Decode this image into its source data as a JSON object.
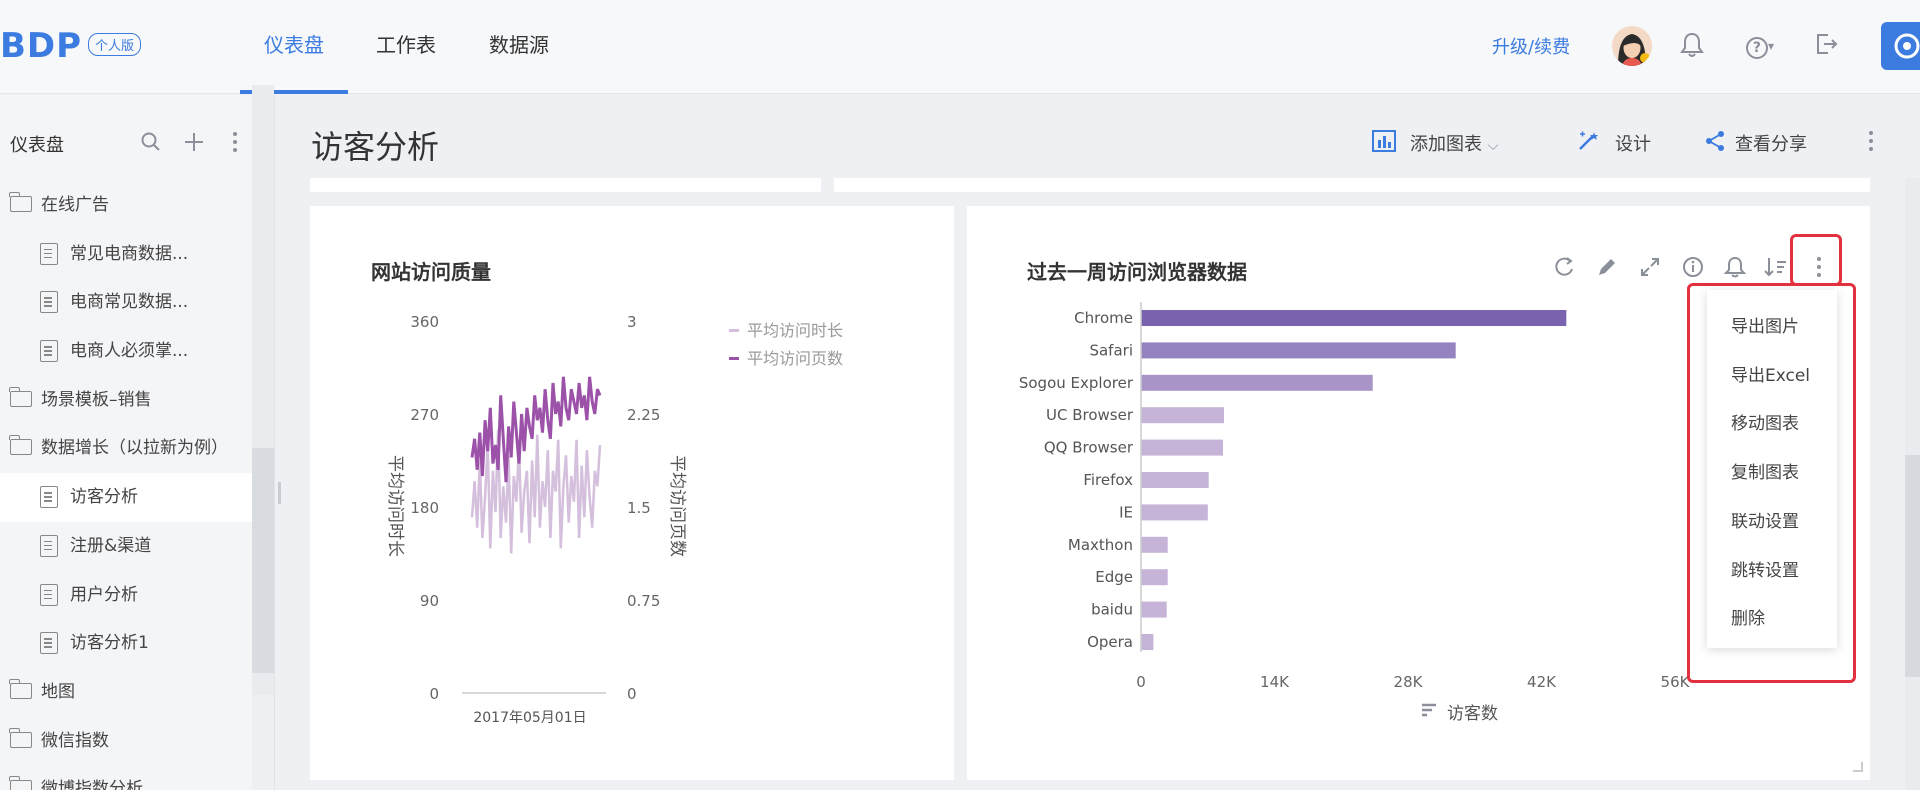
{
  "header": {
    "logo": "BDP",
    "badge": "个人版",
    "tabs": [
      {
        "label": "仪表盘",
        "active": true
      },
      {
        "label": "工作表",
        "active": false
      },
      {
        "label": "数据源",
        "active": false
      }
    ],
    "upgrade": "升级/续费",
    "icons": [
      "avatar",
      "bell-icon",
      "help-icon",
      "logout-icon",
      "support-icon"
    ]
  },
  "sidebar": {
    "title": "仪表盘",
    "items": [
      {
        "label": "在线广告",
        "type": "folder-open"
      },
      {
        "label": "常见电商数据...",
        "type": "doc"
      },
      {
        "label": "电商常见数据...",
        "type": "doc"
      },
      {
        "label": "电商人必须掌...",
        "type": "doc"
      },
      {
        "label": "场景模板–销售",
        "type": "folder"
      },
      {
        "label": "数据增长（以拉新为例）",
        "type": "folder-open"
      },
      {
        "label": "访客分析",
        "type": "doc",
        "selected": true
      },
      {
        "label": "注册&渠道",
        "type": "doc"
      },
      {
        "label": "用户分析",
        "type": "doc"
      },
      {
        "label": "访客分析1",
        "type": "doc"
      },
      {
        "label": "地图",
        "type": "folder"
      },
      {
        "label": "微信指数",
        "type": "folder"
      },
      {
        "label": "微博指数分析",
        "type": "folder"
      }
    ]
  },
  "main": {
    "title": "访客分析",
    "actions": {
      "add_chart": "添加图表",
      "design": "设计",
      "share": "查看分享"
    }
  },
  "chart1": {
    "title": "网站访问质量",
    "left_ticks": [
      "360",
      "270",
      "180",
      "90",
      "0"
    ],
    "right_ticks": [
      "3",
      "2.25",
      "1.5",
      "0.75",
      "0"
    ],
    "ylabel_left": "平均访问时长",
    "ylabel_right": "平均访问页数",
    "xlabel": "2017年05月01日",
    "legend": [
      "平均访问时长",
      "平均访问页数"
    ],
    "colors": {
      "duration": "#d4bfdc",
      "pages": "#9b52a8"
    }
  },
  "chart2": {
    "title": "过去一周访问浏览器数据",
    "xlabel": "访客数",
    "x_ticks": [
      "0",
      "14K",
      "28K",
      "42K",
      "56K"
    ]
  },
  "chart_data": [
    {
      "type": "line",
      "title": "网站访问质量",
      "xlabel": "2017年05月01日",
      "ylabel_left": "平均访问时长",
      "ylabel_right": "平均访问页数",
      "ylim_left": [
        0,
        360
      ],
      "ylim_right": [
        0,
        3
      ],
      "series": [
        {
          "name": "平均访问时长",
          "axis": "left",
          "values": [
            170,
            205,
            160,
            225,
            150,
            190,
            240,
            140,
            215,
            175,
            255,
            150,
            200,
            165,
            230,
            135,
            210,
            185,
            240,
            155,
            195,
            215,
            145,
            225,
            170,
            250,
            160,
            205,
            180,
            235,
            150,
            215,
            195,
            245,
            140,
            200,
            230,
            165,
            210,
            185,
            245,
            150,
            220,
            170,
            235,
            190,
            160,
            215,
            200,
            240
          ]
        },
        {
          "name": "平均访问页数",
          "axis": "right",
          "values": [
            1.9,
            2.05,
            1.8,
            2.1,
            1.75,
            2.2,
            1.95,
            2.3,
            1.85,
            2.0,
            1.8,
            2.4,
            2.05,
            1.7,
            2.15,
            1.9,
            2.35,
            2.1,
            1.85,
            2.25,
            1.95,
            2.3,
            2.15,
            2.05,
            2.4,
            2.2,
            2.3,
            2.1,
            2.45,
            2.2,
            2.05,
            2.5,
            2.25,
            2.35,
            2.15,
            2.55,
            2.3,
            2.2,
            2.45,
            2.35,
            2.25,
            2.5,
            2.3,
            2.4,
            2.2,
            2.55,
            2.35,
            2.25,
            2.45,
            2.4
          ]
        }
      ]
    },
    {
      "type": "bar",
      "orientation": "horizontal",
      "title": "过去一周访问浏览器数据",
      "xlabel": "访客数",
      "xlim": [
        0,
        56000
      ],
      "categories": [
        "Chrome",
        "Safari",
        "Sogou Explorer",
        "UC Browser",
        "QQ Browser",
        "Firefox",
        "IE",
        "Maxthon",
        "Edge",
        "baidu",
        "Opera"
      ],
      "values": [
        44600,
        33000,
        24300,
        8700,
        8600,
        7100,
        7000,
        2800,
        2800,
        2700,
        1300
      ],
      "colors": [
        "#7a63ae",
        "#9583c0",
        "#a994c8",
        "#c6b3d8",
        "#c6b3d8",
        "#c6b3d8",
        "#c6b3d8",
        "#c6b3d8",
        "#c6b3d8",
        "#c6b3d8",
        "#c6b3d8"
      ]
    }
  ],
  "menu": {
    "items": [
      "导出图片",
      "导出Excel",
      "移动图表",
      "复制图表",
      "联动设置",
      "跳转设置",
      "删除"
    ]
  }
}
